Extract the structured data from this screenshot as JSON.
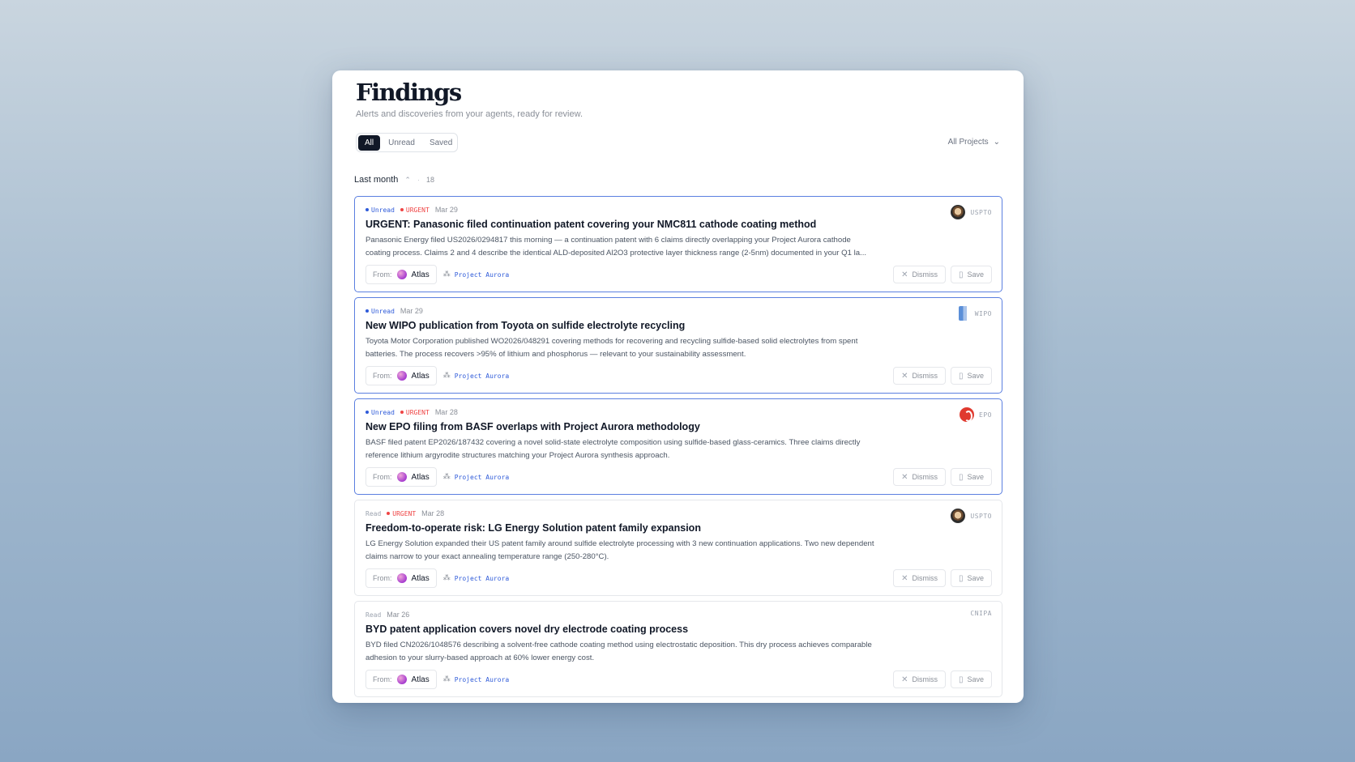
{
  "header": {
    "title": "Findings",
    "subtitle": "Alerts and discoveries from your agents, ready for review."
  },
  "filters": {
    "tabs": [
      "All",
      "Unread",
      "Saved"
    ],
    "active": "All",
    "projects_label": "All Projects"
  },
  "group": {
    "label": "Last month",
    "count": "18"
  },
  "labels": {
    "from": "From:",
    "dismiss": "Dismiss",
    "save": "Save",
    "unread": "Unread",
    "read": "Read",
    "urgent": "URGENT"
  },
  "findings": [
    {
      "status": "Unread",
      "urgent": true,
      "date": "Mar 29",
      "title": "URGENT: Panasonic filed continuation patent covering your NMC811 cathode coating method",
      "description": "Panasonic Energy filed US2026/0294817 this morning — a continuation patent with 6 claims directly overlapping your Project Aurora cathode coating process. Claims 2 and 4 describe the identical ALD-deposited Al2O3 protective layer thickness range (2-5nm) documented in your Q1 la...",
      "source": "USPTO",
      "source_icon": "uspto-logo-icon",
      "agent": "Atlas",
      "project": "Project Aurora"
    },
    {
      "status": "Unread",
      "urgent": false,
      "date": "Mar 29",
      "title": "New WIPO publication from Toyota on sulfide electrolyte recycling",
      "description": "Toyota Motor Corporation published WO2026/048291 covering methods for recovering and recycling sulfide-based solid electrolytes from spent batteries. The process recovers >95% of lithium and phosphorus — relevant to your sustainability assessment.",
      "source": "WIPO",
      "source_icon": "wipo-logo-icon",
      "agent": "Atlas",
      "project": "Project Aurora"
    },
    {
      "status": "Unread",
      "urgent": true,
      "date": "Mar 28",
      "title": "New EPO filing from BASF overlaps with Project Aurora methodology",
      "description": "BASF filed patent EP2026/187432 covering a novel solid-state electrolyte composition using sulfide-based glass-ceramics. Three claims directly reference lithium argyrodite structures matching your Project Aurora synthesis approach.",
      "source": "EPO",
      "source_icon": "epo-logo-icon",
      "agent": "Atlas",
      "project": "Project Aurora"
    },
    {
      "status": "Read",
      "urgent": true,
      "date": "Mar 28",
      "title": "Freedom-to-operate risk: LG Energy Solution patent family expansion",
      "description": "LG Energy Solution expanded their US patent family around sulfide electrolyte processing with 3 new continuation applications. Two new dependent claims narrow to your exact annealing temperature range (250-280°C).",
      "source": "USPTO",
      "source_icon": "uspto-logo-icon",
      "agent": "Atlas",
      "project": "Project Aurora"
    },
    {
      "status": "Read",
      "urgent": false,
      "date": "Mar 26",
      "title": "BYD patent application covers novel dry electrode coating process",
      "description": "BYD filed CN2026/1048576 describing a solvent-free cathode coating method using electrostatic deposition. This dry process achieves comparable adhesion to your slurry-based approach at 60% lower energy cost.",
      "source": "CNIPA",
      "source_icon": "",
      "agent": "Atlas",
      "project": "Project Aurora"
    }
  ]
}
